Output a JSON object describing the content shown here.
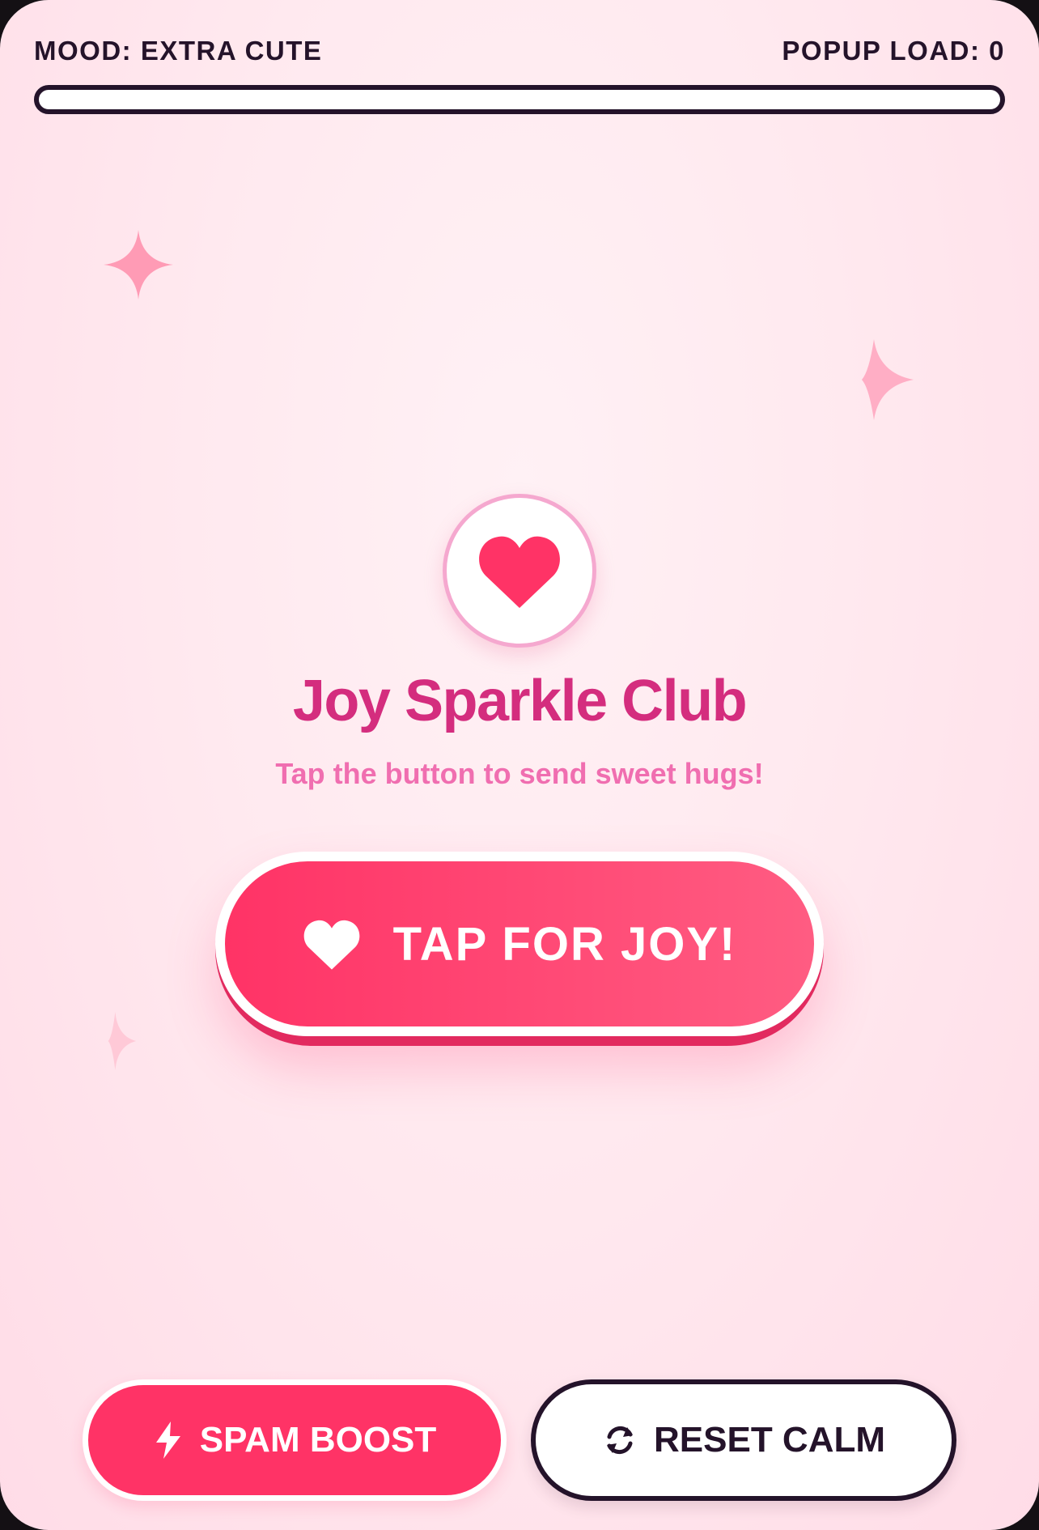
{
  "status": {
    "mood_label": "MOOD: EXTRA CUTE",
    "popup_load_label": "POPUP LOAD: 0",
    "popup_load_percent": 0
  },
  "hero": {
    "icon": "heart-icon",
    "title": "Joy Sparkle Club",
    "subtitle": "Tap the button to send sweet hugs!"
  },
  "main_button": {
    "icon": "heart-icon",
    "label": "TAP FOR JOY!"
  },
  "actions": {
    "spam": {
      "icon": "lightning-icon",
      "label": "SPAM BOOST"
    },
    "reset": {
      "icon": "refresh-icon",
      "label": "RESET CALM"
    }
  },
  "colors": {
    "accent": "#ff3366",
    "title": "#d42d7e",
    "subtitle": "#f06eb0",
    "dark": "#24132a",
    "badge_ring": "#f5a8cf",
    "sparkle": "#ff9bb5"
  }
}
